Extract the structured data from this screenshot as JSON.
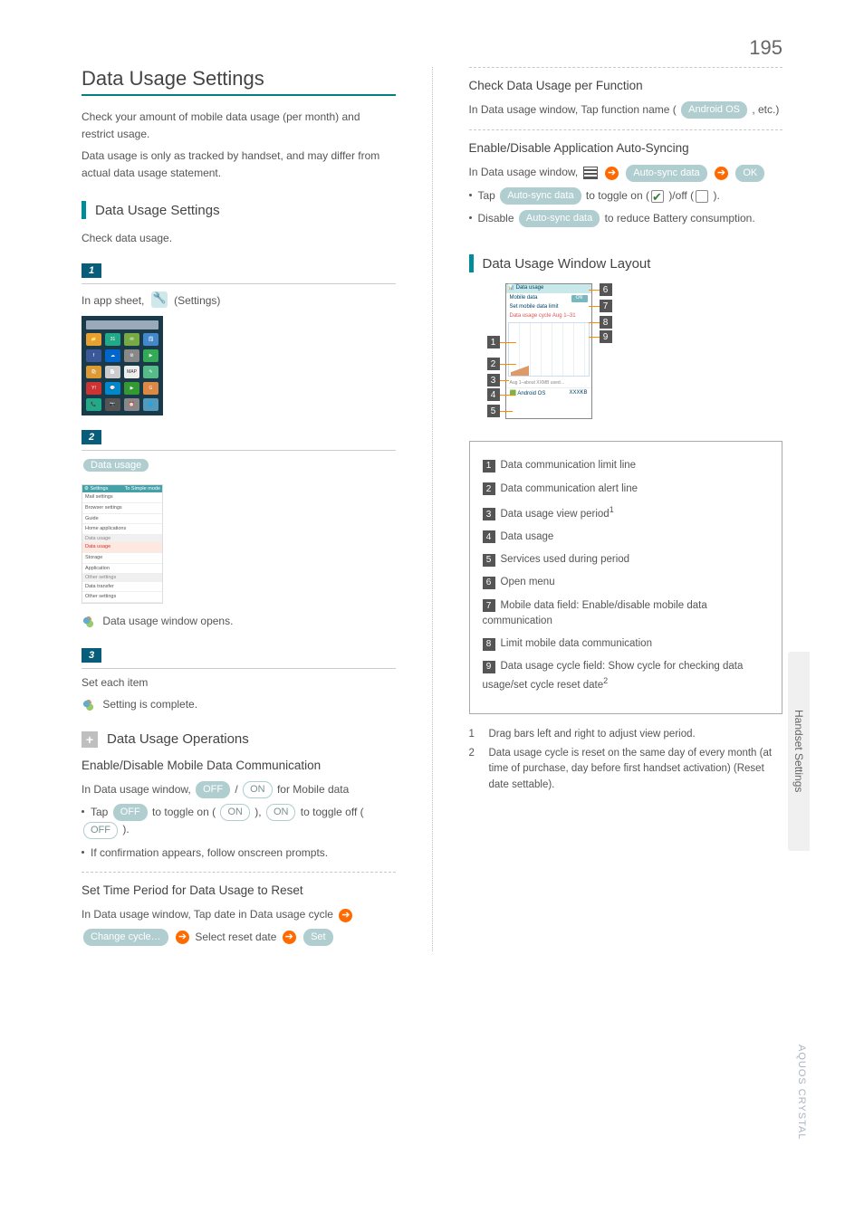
{
  "page_number": "195",
  "side_tab": "Handset Settings",
  "product_name": "AQUOS CRYSTAL",
  "left": {
    "title": "Data Usage Settings",
    "intro1": "Check your amount of mobile data usage (per month) and restrict usage.",
    "intro2": "Data usage is only as tracked by handset, and may differ from actual data usage statement.",
    "sub1": "Data Usage Settings",
    "sub1_desc": "Check data usage.",
    "step1_pre": "In app sheet, ",
    "step1_post": " (Settings)",
    "step2_btn": "Data usage",
    "step2_result": "Data usage window opens.",
    "step3_text": "Set each item",
    "step3_result": "Setting is complete.",
    "ops_title": "Data Usage Operations",
    "op1_h": "Enable/Disable Mobile Data Communication",
    "op1_l1_pre": "In Data usage window, ",
    "off": "OFF",
    "on": "ON",
    "op1_l1_post": " for Mobile data",
    "op1_b1a": "Tap ",
    "op1_b1b": " to toggle on (",
    "op1_b1c": "), ",
    "op1_b1d": " to toggle off (",
    "op1_b1e": ").",
    "op1_b2": "If confirmation appears, follow onscreen prompts.",
    "op2_h": "Set Time Period for Data Usage to Reset",
    "op2_l1": "In Data usage window, Tap date in Data usage cycle ",
    "op2_btn1": "Change cycle…",
    "op2_mid": " Select reset date ",
    "op2_btn2": "Set",
    "settings_list": {
      "title": "Settings",
      "right": "To Simple mode",
      "i1": "Mail settings",
      "i2": "Browser settings",
      "i3": "Guide",
      "i4": "Home applications",
      "s1": "Data usage",
      "sel": "Data usage",
      "i5": "Storage",
      "i6": "Application",
      "s2": "Other settings",
      "i7": "Data transfer",
      "i8": "Other settings"
    }
  },
  "right": {
    "op3_h": "Check Data Usage per Function",
    "op3_l1a": "In Data usage window, Tap function name (",
    "op3_btn": "Android OS",
    "op3_l1b": " , etc.)",
    "op4_h": "Enable/Disable Application Auto-Syncing",
    "op4_l1": "In Data usage window, ",
    "op4_btn1": "Auto-sync data",
    "op4_btn2": "OK",
    "op4_b1a": "Tap ",
    "op4_b1b": " to toggle on (",
    "op4_b1c": ")/off (",
    "op4_b1d": ").",
    "op4_b2a": "Disable ",
    "op4_b2b": " to reduce Battery consumption.",
    "sub2": "Data Usage Window Layout",
    "layout": {
      "i1": "Data communication limit line",
      "i2": "Data communication alert line",
      "i3": "Data usage view period",
      "i4": "Data usage",
      "i5": "Services used during period",
      "i6": "Open menu",
      "i7": "Mobile data field: Enable/disable mobile data communication",
      "i8": "Limit mobile data communication",
      "i9": "Data usage cycle field: Show cycle for checking data usage/set cycle reset date"
    },
    "foot1": "Drag bars left and right to adjust view period.",
    "foot2": "Data usage cycle is reset on the same day of every month (at time of purchase, day before first handset activation) (Reset date settable).",
    "diag": {
      "title": "Data usage",
      "mobile": "Mobile data",
      "limit": "Set mobile data limit",
      "cycle": "Data usage cycle  Aug 1–31",
      "usage": "Aug 1–about XXMB used…",
      "app": "Android OS",
      "sz": "XXXKB"
    }
  }
}
